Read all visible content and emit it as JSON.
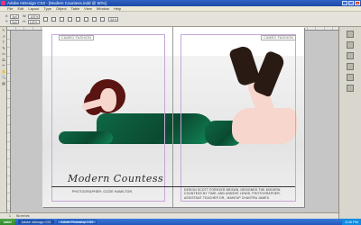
{
  "window": {
    "title": "Adobe InDesign CS3 - [Modern Countess.indd @ 50%]",
    "controls": [
      "_",
      "□",
      "×"
    ]
  },
  "menu": {
    "items": [
      "File",
      "Edit",
      "Layout",
      "Type",
      "Object",
      "Table",
      "View",
      "Window",
      "Help"
    ]
  },
  "control_bar": {
    "x_label": "X:",
    "x_value": "0p0",
    "y_label": "Y:",
    "y_value": "0p0",
    "w_label": "W:",
    "w_value": "100%",
    "h_label": "H:",
    "h_value": "100%",
    "zoom": "50%"
  },
  "tools": [
    "↖",
    "↗",
    "T",
    "✎",
    "▭",
    "⬭",
    "✂",
    "✋",
    "🔍",
    "▤"
  ],
  "document": {
    "running_head_left": "CAMEO FASHION",
    "running_head_right": "CAMEO FASHION",
    "title": "Modern Countess",
    "credits": "PHOTOGRAPHER: OZZIE HAMILTON",
    "body": "DESIGN SCOTT FOREVER BROWN, DESIGNED THE MODERN COUNTESS BY TIME, AND ANNEXE LEWIS, PHOTOGRAPHER, ASSISTANT TEACHER DR., MAKEUP CHANTRA JAMES."
  },
  "status": {
    "page": "1",
    "state": "No errors"
  },
  "taskbar": {
    "start": "start",
    "items": [
      "Adobe InDesign CS3",
      "Adobe Photoshop CS3"
    ],
    "clock": "3:06 PM"
  },
  "colors": {
    "dress": "#0e6845",
    "hair": "#5a1412",
    "titlebar": "#2f63c4"
  }
}
